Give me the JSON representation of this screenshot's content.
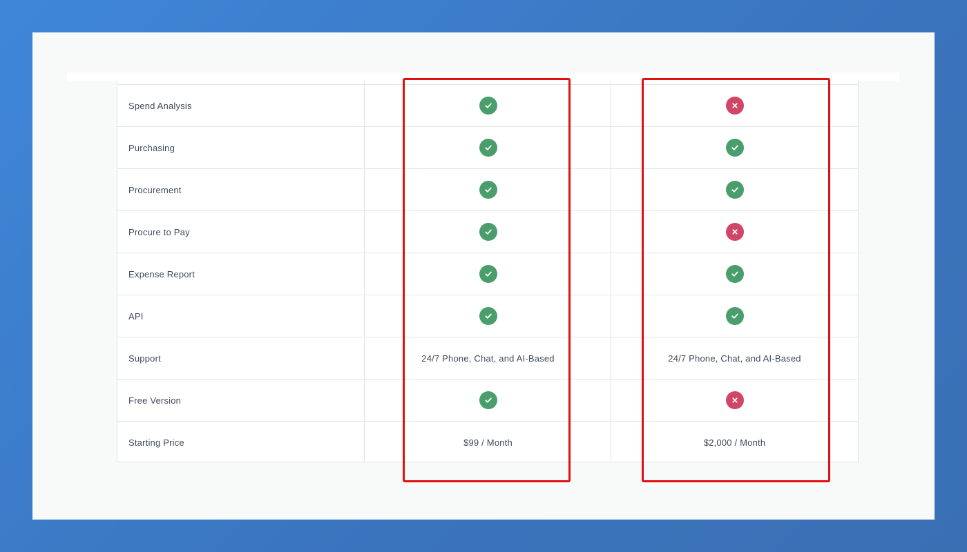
{
  "colors": {
    "check": "#4a9e6c",
    "cross": "#d14668",
    "highlight": "#e01010"
  },
  "table": {
    "rows": [
      {
        "label": "Spend Analysis",
        "a": {
          "icon": "check-icon"
        },
        "b": {
          "icon": "cross-icon"
        }
      },
      {
        "label": "Purchasing",
        "a": {
          "icon": "check-icon"
        },
        "b": {
          "icon": "check-icon"
        }
      },
      {
        "label": "Procurement",
        "a": {
          "icon": "check-icon"
        },
        "b": {
          "icon": "check-icon"
        }
      },
      {
        "label": "Procure to Pay",
        "a": {
          "icon": "check-icon"
        },
        "b": {
          "icon": "cross-icon"
        }
      },
      {
        "label": "Expense Report",
        "a": {
          "icon": "check-icon"
        },
        "b": {
          "icon": "check-icon"
        }
      },
      {
        "label": "API",
        "a": {
          "icon": "check-icon"
        },
        "b": {
          "icon": "check-icon"
        }
      },
      {
        "label": "Support",
        "a": {
          "text": "24/7 Phone, Chat, and AI-Based"
        },
        "b": {
          "text": "24/7 Phone, Chat, and AI-Based"
        }
      },
      {
        "label": "Free Version",
        "a": {
          "icon": "check-icon"
        },
        "b": {
          "icon": "cross-icon"
        }
      },
      {
        "label": "Starting Price",
        "a": {
          "text": "$99 / Month"
        },
        "b": {
          "text": "$2,000 / Month"
        }
      }
    ]
  }
}
